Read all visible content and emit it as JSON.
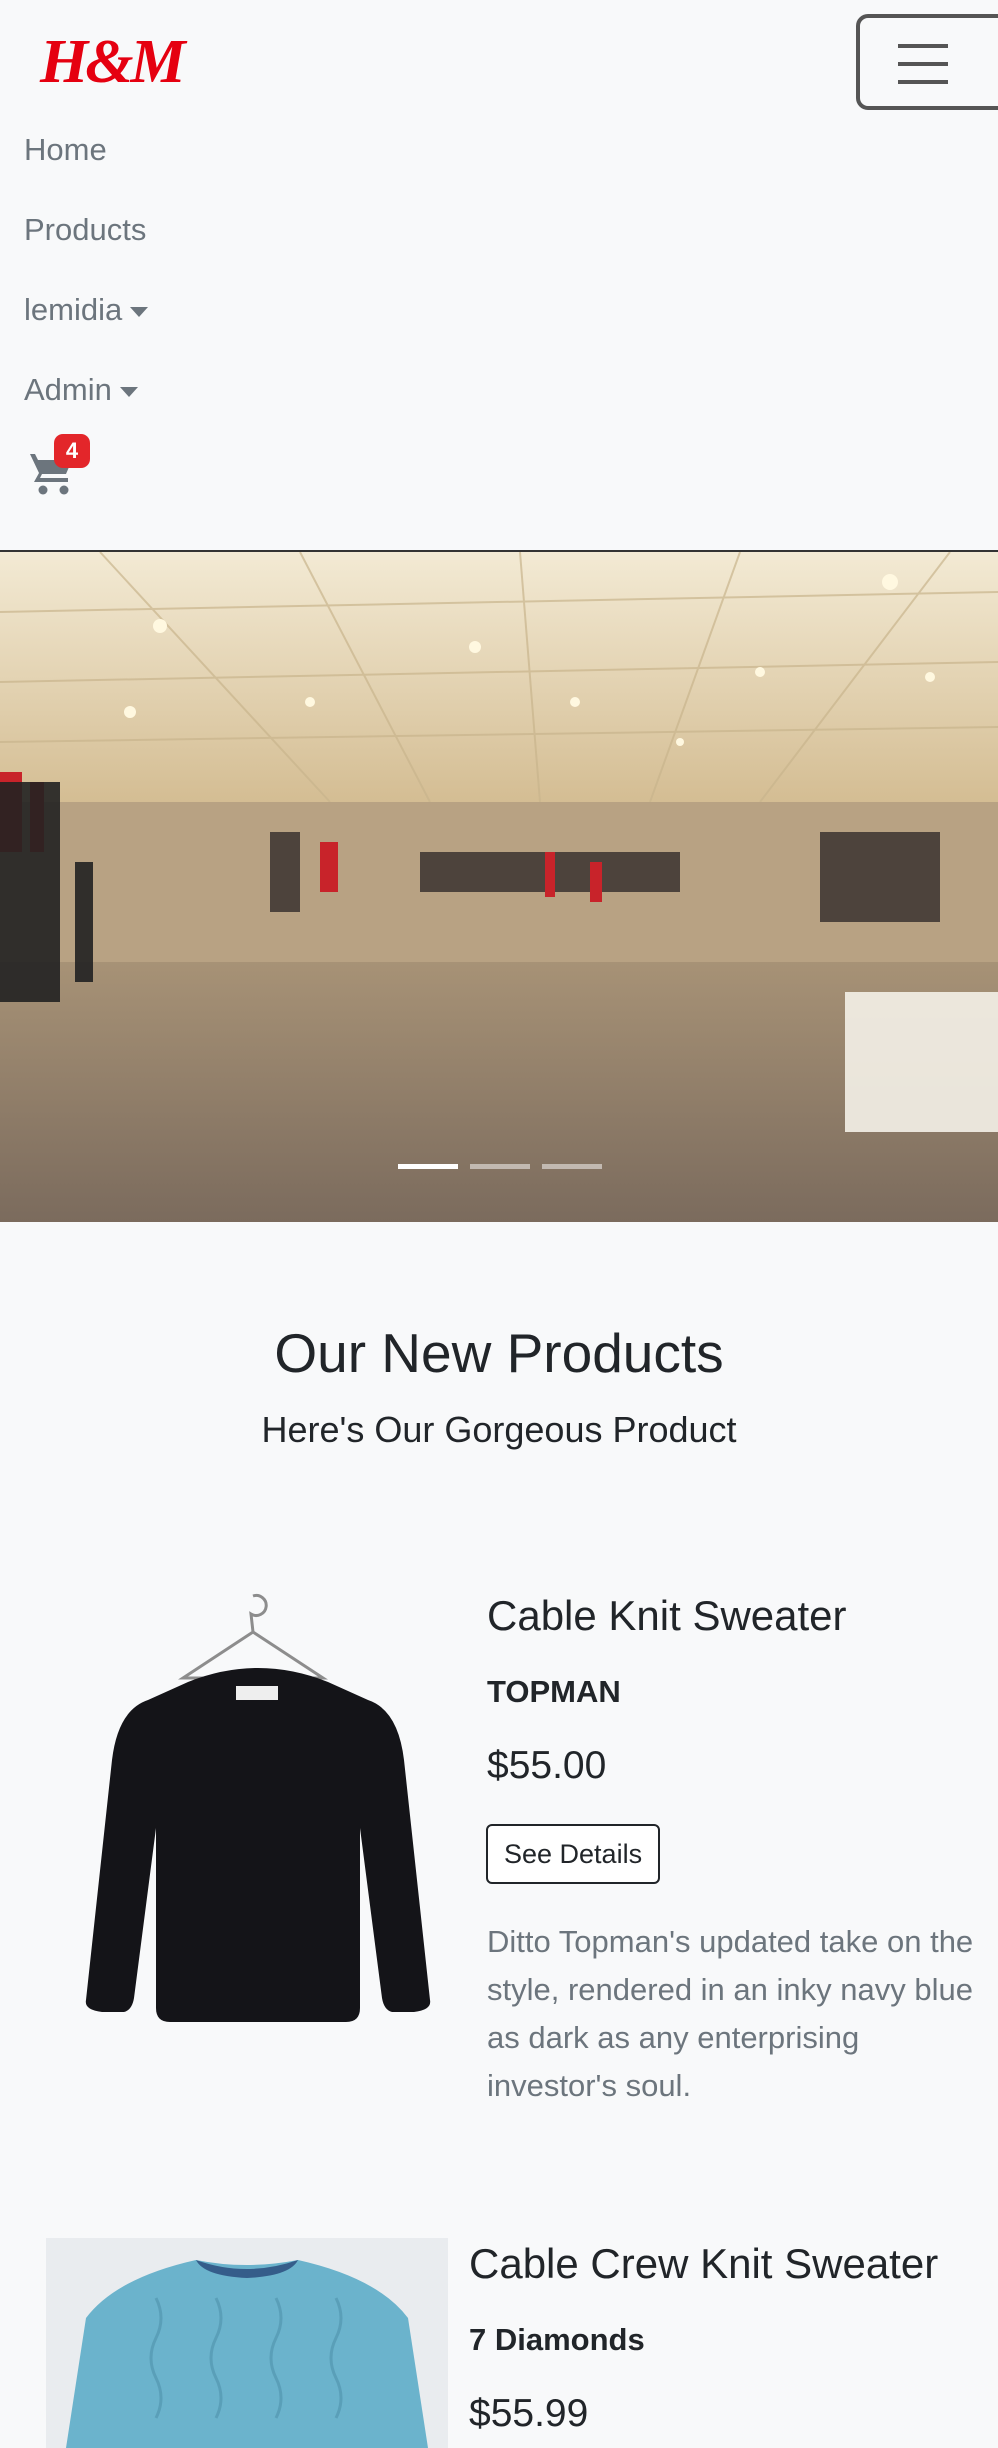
{
  "brand": {
    "logo_text": "H&M",
    "color": "#e50010"
  },
  "nav": {
    "items": [
      {
        "label": "Home",
        "dropdown": false
      },
      {
        "label": "Products",
        "dropdown": false
      },
      {
        "label": "lemidia",
        "dropdown": true
      },
      {
        "label": "Admin",
        "dropdown": true
      }
    ],
    "cart_count": "4",
    "cart_icon": "shopping-cart-icon",
    "toggler_icon": "hamburger-menu-icon"
  },
  "hero": {
    "slide_count": 3,
    "active_slide": 1
  },
  "section": {
    "title": "Our New Products",
    "subtitle": "Here's Our Gorgeous Product"
  },
  "products": [
    {
      "name": "Cable Knit Sweater",
      "brand": "TOPMAN",
      "price": "$55.00",
      "button_label": "See Details",
      "description": "Ditto Topman's updated take on the style, rendered in an inky navy blue as dark as any enterprising investor's soul.",
      "image_color": "#141418"
    },
    {
      "name": "Cable Crew Knit Sweater",
      "brand": "7 Diamonds",
      "price": "$55.99",
      "image_color": "#6bb3cc"
    }
  ],
  "colors": {
    "page_bg": "#f8f9fa",
    "badge": "#e3262a",
    "text": "#212529",
    "muted": "#6c757d"
  }
}
